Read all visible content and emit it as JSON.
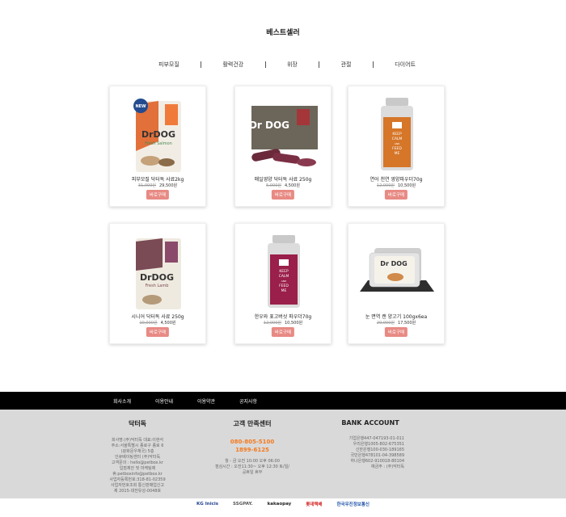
{
  "section_title": "베스트셀러",
  "tabs": [
    "피부모질",
    "활력건강",
    "위장",
    "관절",
    "다이어트"
  ],
  "products": [
    {
      "name": "피부모질 닥터독 사료2kg",
      "old_price": "31,000원",
      "price": "29,500원",
      "buy": "바로구매",
      "badge": "NEW",
      "brand": "DrDOG",
      "sub": "Fresh Salmon"
    },
    {
      "name": "매일영양 닥터독 사료 250g",
      "old_price": "5,000원",
      "price": "4,500원",
      "buy": "바로구매",
      "brand": "Dr DOG"
    },
    {
      "name": "연어 천연 영양파우더70g",
      "old_price": "12,000원",
      "price": "10,500원",
      "buy": "바로구매",
      "jar_text": [
        "KEEP",
        "CALM",
        "AND",
        "FEED",
        "ME"
      ]
    },
    {
      "name": "시니어 닥터독 사료 250g",
      "old_price": "10,000원",
      "price": "4,500원",
      "buy": "바로구매",
      "brand": "DrDOG",
      "sub": "Fresh Lamb"
    },
    {
      "name": "한우와 표고버섯 파우더70g",
      "old_price": "12,000원",
      "price": "10,500원",
      "buy": "바로구매",
      "jar_text": [
        "KEEP",
        "CALM",
        "AND",
        "FEED",
        "ME"
      ]
    },
    {
      "name": "눈 면역 캔 양고기 100gx6ea",
      "old_price": "20,000원",
      "price": "17,500원",
      "buy": "바로구매",
      "brand": "Dr DOG"
    }
  ],
  "footer_nav": [
    "회사소개",
    "이용안내",
    "이용약관",
    "공지사항"
  ],
  "footer": {
    "company_title": "닥터독",
    "company_lines": [
      "회사명:(주)닥터독 대표:이현석",
      "주소:서울특별시 종로구 종로 6",
      "(광화문우체국) 5층",
      "인큐베이팅센터 (주)닥터독",
      "고객문의 : hello@petbox.kr",
      "입점제안 및 마케팅제",
      "휴:petboxinfo@petbox.kr",
      "사업자등록번호:318-81-02359",
      "사업자번호조회 통신판매업신고",
      "제 2015-대전유성-0048호"
    ],
    "cs_title": "고객 만족센터",
    "cs_phones": [
      "080-805-5100",
      "1899-6125"
    ],
    "cs_lines": [
      "월 - 금 오전 10:00 오후 06:00",
      "점심시간 : 오전11:30~ 오후 12:30 토/일/",
      "공휴일 휴무"
    ],
    "bank_title": "BANK ACCOUNT",
    "bank_lines": [
      "기업은행447-047193-01-011",
      "우리은행1005-802-675351",
      "신한은행100-030-189165",
      "국민은행478101-04-398589",
      "하나은행602-910018-80104",
      "예금주 : (주)닥터독"
    ]
  },
  "pay_logos": [
    {
      "name": "KG Inicis",
      "color": "#1d3f8f"
    },
    {
      "name": "SSGPAY.",
      "color": "#555555"
    },
    {
      "name": "kakaopay",
      "color": "#222222"
    },
    {
      "name": "롯데택배",
      "color": "#d0201e"
    },
    {
      "name": "한국우진정보통신",
      "color": "#2255aa"
    }
  ]
}
